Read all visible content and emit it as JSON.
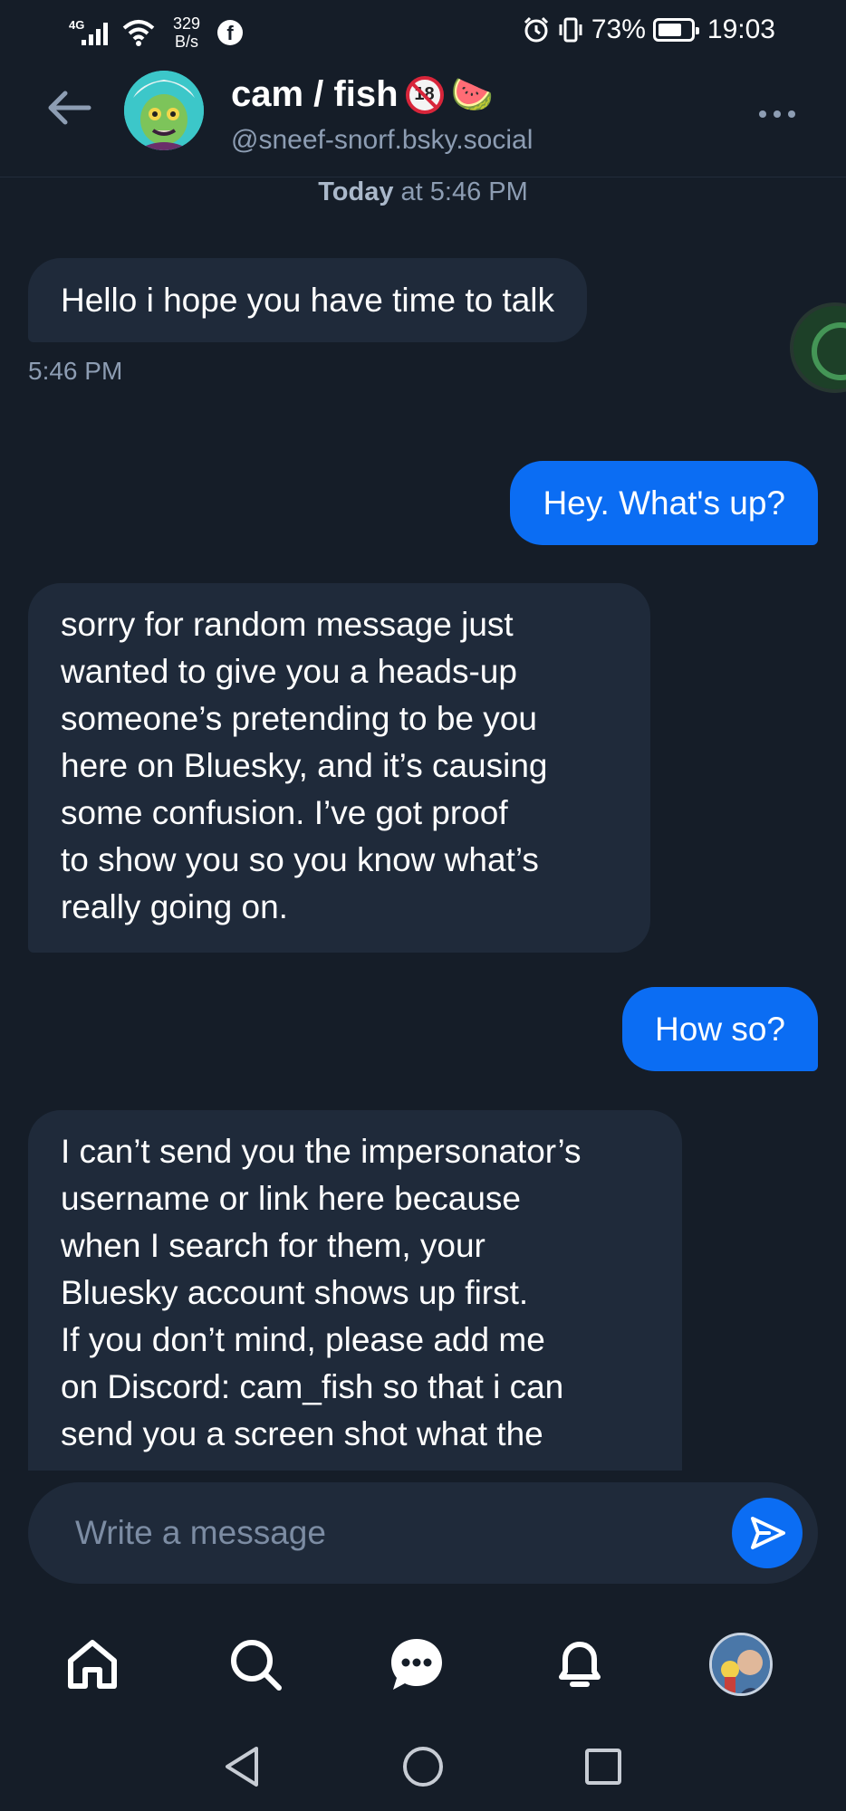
{
  "status_bar": {
    "network": "4G",
    "speed_value": "329",
    "speed_unit": "B/s",
    "battery": "73%",
    "battery_level": 0.73,
    "time": "19:03"
  },
  "header": {
    "name": "cam / fish",
    "handle": "@sneef-snorf.bsky.social",
    "badge_text": "18",
    "emoji": "🍉"
  },
  "chat": {
    "date_day": "Today",
    "date_rest": " at 5:46 PM",
    "messages": [
      {
        "dir": "in",
        "text": "Hello i hope you have time to talk",
        "time": "5:46 PM"
      },
      {
        "dir": "out",
        "text": "Hey. What's up?"
      },
      {
        "dir": "in",
        "lines": [
          "sorry for random message just",
          "wanted to give you a heads-up",
          "someone’s pretending to be you",
          "here on Bluesky, and it’s causing",
          "some confusion. I’ve got proof",
          "to show you so you know what’s",
          "really going on."
        ]
      },
      {
        "dir": "out",
        "text": "How so?"
      },
      {
        "dir": "in",
        "lines": [
          "I can’t send you the impersonator’s",
          "username or link here because",
          "when I search for them, your",
          "Bluesky account shows up first.",
          "If you don’t mind, please add me",
          "on Discord: cam_fish so that i can",
          "send you a screen shot what the"
        ]
      }
    ]
  },
  "composer": {
    "placeholder": "Write a message"
  },
  "icons": {
    "back": "arrow-left-icon",
    "more": "more-horizontal-icon",
    "send": "send-icon",
    "home": "home-icon",
    "search": "search-icon",
    "chat": "chat-icon",
    "bell": "bell-icon",
    "whatsapp": "whatsapp-icon"
  },
  "colors": {
    "background": "#151d28",
    "incoming_bubble": "#1f2a3a",
    "outgoing_bubble": "#0b6df3",
    "muted_text": "#8d9db3"
  }
}
